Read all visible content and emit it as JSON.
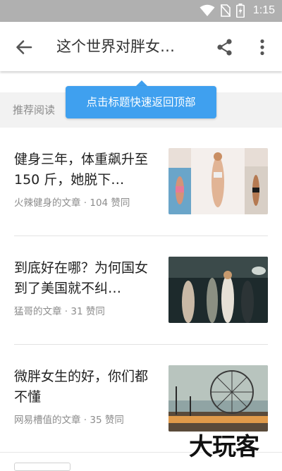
{
  "status_bar": {
    "time": "1:15"
  },
  "toolbar": {
    "title": "这个世界对胖女…"
  },
  "section": {
    "label": "推荐阅读"
  },
  "tooltip": {
    "text": "点击标题快速返回顶部"
  },
  "articles": [
    {
      "title": "健身三年，体重飙升至 150 斤，她脱下…",
      "meta": "火辣健身的文章 · 104 赞同"
    },
    {
      "title": "到底好在哪？为何国女到了美国就不纠…",
      "meta": "猛哥的文章 · 31 赞同"
    },
    {
      "title": "微胖女生的好，你们都不懂",
      "meta": "网易槽值的文章 · 35 赞同"
    }
  ],
  "watermark": {
    "text": "大玩客"
  },
  "colors": {
    "accent": "#3fa0ef",
    "statusbar": "#b0b0b0",
    "section_bg": "#f2f2f2"
  }
}
